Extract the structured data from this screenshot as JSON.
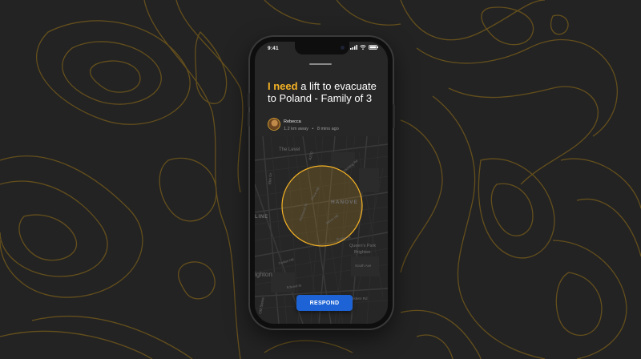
{
  "status_bar": {
    "time": "9:41"
  },
  "request": {
    "title_highlight": "I need",
    "title_rest": " a lift to evacuate to Poland - Family of 3"
  },
  "requester": {
    "name": "Rebecca",
    "distance": "1.2 km away",
    "separator": "•",
    "time_ago": "8 mins ago"
  },
  "map": {
    "labels": {
      "the_level": "The Level",
      "hanover": "HANOVE",
      "line": "LINE",
      "queens_park_1": "Queen's Park",
      "queens_park_2": "Brighton",
      "brighton": "ighton",
      "south_ave": "South Ave",
      "eastern_rd": "Eastern Rd",
      "old_steine": "Old Steine",
      "a270": "A270",
      "elm_gr": "Elm Gr",
      "richmond_st": "Richmond St",
      "grove_hill": "Grove Hill",
      "albion_hill": "Albion Hill",
      "sussex_st": "Sussex St",
      "ditchling": "Ditchling Rd",
      "edward_st": "Edward St",
      "carlton_hill": "Carlton Hill"
    }
  },
  "actions": {
    "respond_label": "RESPOND"
  },
  "colors": {
    "accent": "#f5b325",
    "button": "#1d63d6",
    "background": "#232323",
    "topo_lines": "#8a6a1c"
  }
}
